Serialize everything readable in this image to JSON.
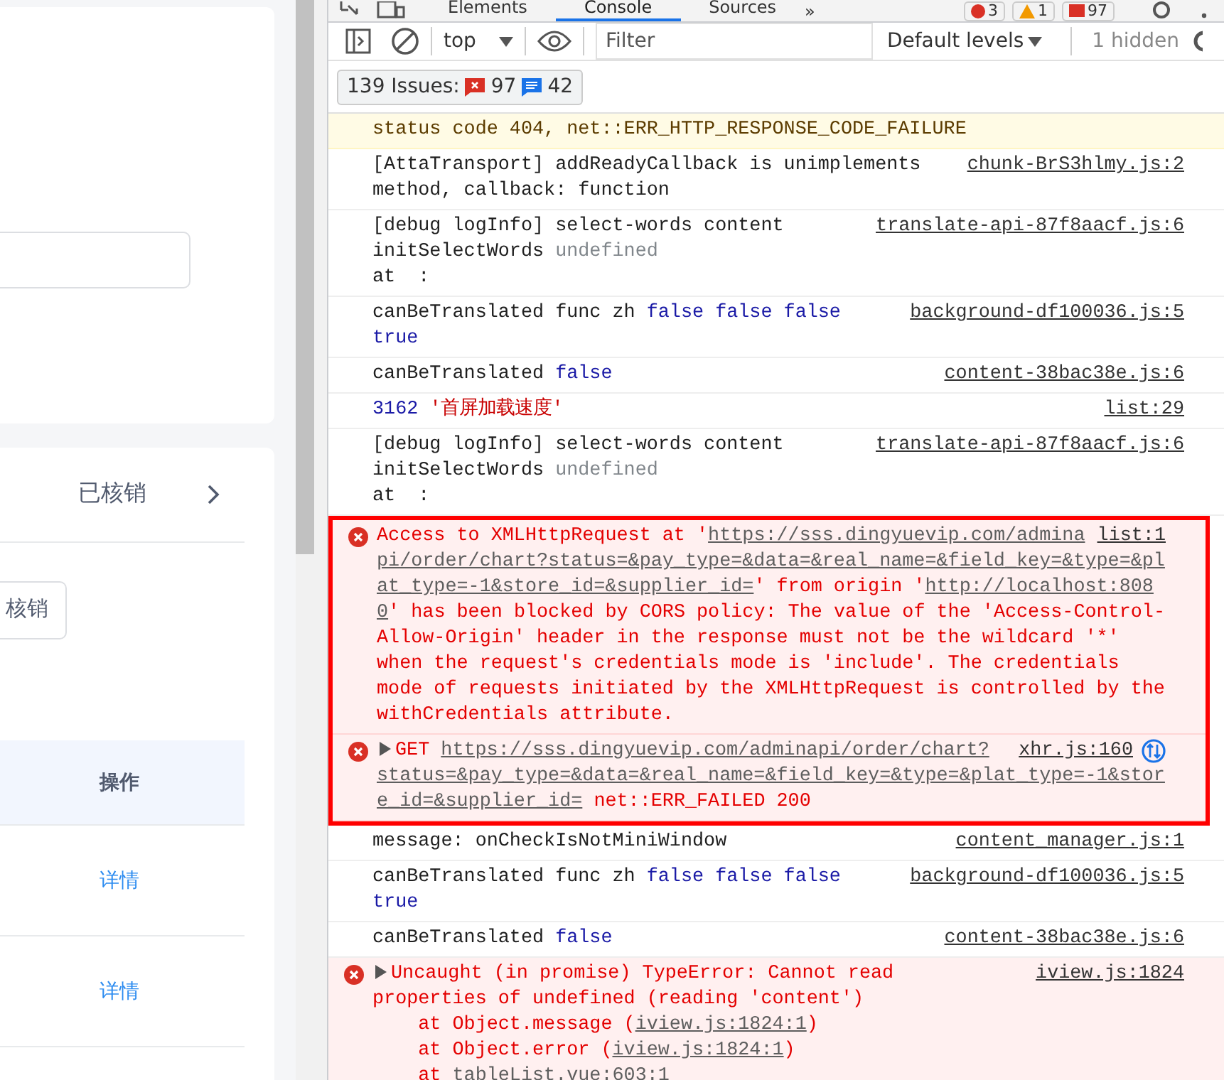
{
  "left_page": {
    "status_tab": {
      "label": "已核销"
    },
    "action_button": {
      "label": "核销"
    },
    "table": {
      "columns": [
        "操作"
      ],
      "rows": [
        {
          "action": "详情"
        },
        {
          "action": "详情"
        }
      ]
    }
  },
  "devtools": {
    "tabs": [
      {
        "label": "Elements",
        "selected": false
      },
      {
        "label": "Console",
        "selected": true
      },
      {
        "label": "Sources",
        "selected": false
      }
    ],
    "more_tabs": "»",
    "badges": [
      {
        "kind": "error",
        "count": "3"
      },
      {
        "kind": "warning",
        "count": "1"
      },
      {
        "kind": "issues",
        "count": "97"
      }
    ],
    "toolbar": {
      "context": "top",
      "filter": {
        "placeholder": "Filter"
      },
      "levels": "Default levels",
      "hidden": "1 hidden"
    },
    "issues": {
      "label": "139 Issues:",
      "errors": "97",
      "infos": "42"
    },
    "messages": [
      {
        "kind": "warning",
        "highlighted": false,
        "expandable": false,
        "lines": [
          [
            {
              "kind": "text",
              "text": "status code 404, net::ERR_HTTP_RESPONSE_CODE_FAILURE"
            }
          ]
        ]
      },
      {
        "kind": "info",
        "highlighted": false,
        "expandable": false,
        "source": "chunk-BrS3hlmy.js:2",
        "lines": [
          [
            {
              "kind": "text",
              "text": "[AttaTransport] addReadyCallback is unimplements"
            }
          ],
          [
            {
              "kind": "text",
              "text": "method, callback: function"
            }
          ]
        ]
      },
      {
        "kind": "info",
        "highlighted": false,
        "expandable": false,
        "source": "translate-api-87f8aacf.js:6",
        "lines": [
          [
            {
              "kind": "text",
              "text": "[debug logInfo] select-words content"
            }
          ],
          [
            {
              "kind": "text",
              "text": "initSelectWords "
            },
            {
              "kind": "muted",
              "text": "undefined"
            }
          ],
          [
            {
              "kind": "text",
              "text": "at  :"
            }
          ]
        ]
      },
      {
        "kind": "info",
        "highlighted": false,
        "expandable": false,
        "source": "background-df100036.js:5",
        "lines": [
          [
            {
              "kind": "text",
              "text": "canBeTranslated func zh "
            },
            {
              "kind": "keyword",
              "text": "false false false"
            }
          ],
          [
            {
              "kind": "keyword",
              "text": "true"
            }
          ]
        ]
      },
      {
        "kind": "info",
        "highlighted": false,
        "expandable": false,
        "source": "content-38bac38e.js:6",
        "lines": [
          [
            {
              "kind": "text",
              "text": "canBeTranslated "
            },
            {
              "kind": "keyword",
              "text": "false"
            }
          ]
        ]
      },
      {
        "kind": "info",
        "highlighted": false,
        "expandable": false,
        "source": "list:29",
        "lines": [
          [
            {
              "kind": "keyword",
              "text": "3162"
            },
            {
              "kind": "string",
              "text": "'首屏加载速度'"
            }
          ]
        ]
      },
      {
        "kind": "info",
        "highlighted": false,
        "expandable": false,
        "source": "translate-api-87f8aacf.js:6",
        "lines": [
          [
            {
              "kind": "text",
              "text": "[debug logInfo] select-words content"
            }
          ],
          [
            {
              "kind": "text",
              "text": "initSelectWords "
            },
            {
              "kind": "muted",
              "text": "undefined"
            }
          ],
          [
            {
              "kind": "text",
              "text": "at  :"
            }
          ]
        ]
      },
      {
        "kind": "error",
        "highlighted": true,
        "expandable": false,
        "source": "list:1",
        "lines": [
          [
            {
              "kind": "text",
              "text": "Access to XMLHttpRequest at '"
            },
            {
              "kind": "link",
              "text": "https://sss.dingyuevip.com/admina"
            }
          ],
          [
            {
              "kind": "link",
              "text": "pi/order/chart?status=&pay_type=&data=&real_name=&field_key=&type=&pl"
            }
          ],
          [
            {
              "kind": "link",
              "text": "at_type=-1&store_id=&supplier_id="
            },
            {
              "kind": "text",
              "text": "' from origin '"
            },
            {
              "kind": "link",
              "text": "http://localhost:808"
            }
          ],
          [
            {
              "kind": "link",
              "text": "0"
            },
            {
              "kind": "text",
              "text": "' has been blocked by CORS policy: The value of the 'Access-Control-"
            }
          ],
          [
            {
              "kind": "text",
              "text": "Allow-Origin' header in the response must not be the wildcard '*'"
            }
          ],
          [
            {
              "kind": "text",
              "text": "when the request's credentials mode is 'include'. The credentials"
            }
          ],
          [
            {
              "kind": "text",
              "text": "mode of requests initiated by the XMLHttpRequest is controlled by the"
            }
          ],
          [
            {
              "kind": "text",
              "text": "withCredentials attribute."
            }
          ]
        ]
      },
      {
        "kind": "error",
        "highlighted": true,
        "expandable": true,
        "network_icon": true,
        "source": "xhr.js:160",
        "lines": [
          [
            {
              "kind": "text",
              "text": "GET "
            },
            {
              "kind": "link",
              "text": "https://sss.dingyuevip.com/adminapi/order/chart?"
            }
          ],
          [
            {
              "kind": "link",
              "text": "status=&pay_type=&data=&real_name=&field_key=&type=&plat_type=-1&stor"
            }
          ],
          [
            {
              "kind": "link",
              "text": "e_id=&supplier_id="
            },
            {
              "kind": "text",
              "text": " net::ERR_FAILED 200"
            }
          ]
        ]
      },
      {
        "kind": "info",
        "highlighted": false,
        "expandable": false,
        "source": "content_manager.js:1",
        "lines": [
          [
            {
              "kind": "text",
              "text": "message: onCheckIsNotMiniWindow"
            }
          ]
        ]
      },
      {
        "kind": "info",
        "highlighted": false,
        "expandable": false,
        "source": "background-df100036.js:5",
        "lines": [
          [
            {
              "kind": "text",
              "text": "canBeTranslated func zh "
            },
            {
              "kind": "keyword",
              "text": "false false false"
            }
          ],
          [
            {
              "kind": "keyword",
              "text": "true"
            }
          ]
        ]
      },
      {
        "kind": "info",
        "highlighted": false,
        "expandable": false,
        "source": "content-38bac38e.js:6",
        "lines": [
          [
            {
              "kind": "text",
              "text": "canBeTranslated "
            },
            {
              "kind": "keyword",
              "text": "false"
            }
          ]
        ]
      },
      {
        "kind": "error",
        "highlighted": false,
        "expandable": true,
        "source": "iview.js:1824",
        "lines": [
          [
            {
              "kind": "text",
              "text": "Uncaught (in promise) TypeError: Cannot read"
            }
          ],
          [
            {
              "kind": "text",
              "text": "properties of undefined (reading 'content')"
            }
          ],
          [
            {
              "kind": "text",
              "text": "    at Object.message ("
            },
            {
              "kind": "link",
              "text": "iview.js:1824:1"
            },
            {
              "kind": "text",
              "text": ")"
            }
          ],
          [
            {
              "kind": "text",
              "text": "    at Object.error ("
            },
            {
              "kind": "link",
              "text": "iview.js:1824:1"
            },
            {
              "kind": "text",
              "text": ")"
            }
          ],
          [
            {
              "kind": "text",
              "text": "    at "
            },
            {
              "kind": "link",
              "text": "tableList.vue:603:1"
            }
          ]
        ]
      }
    ]
  }
}
